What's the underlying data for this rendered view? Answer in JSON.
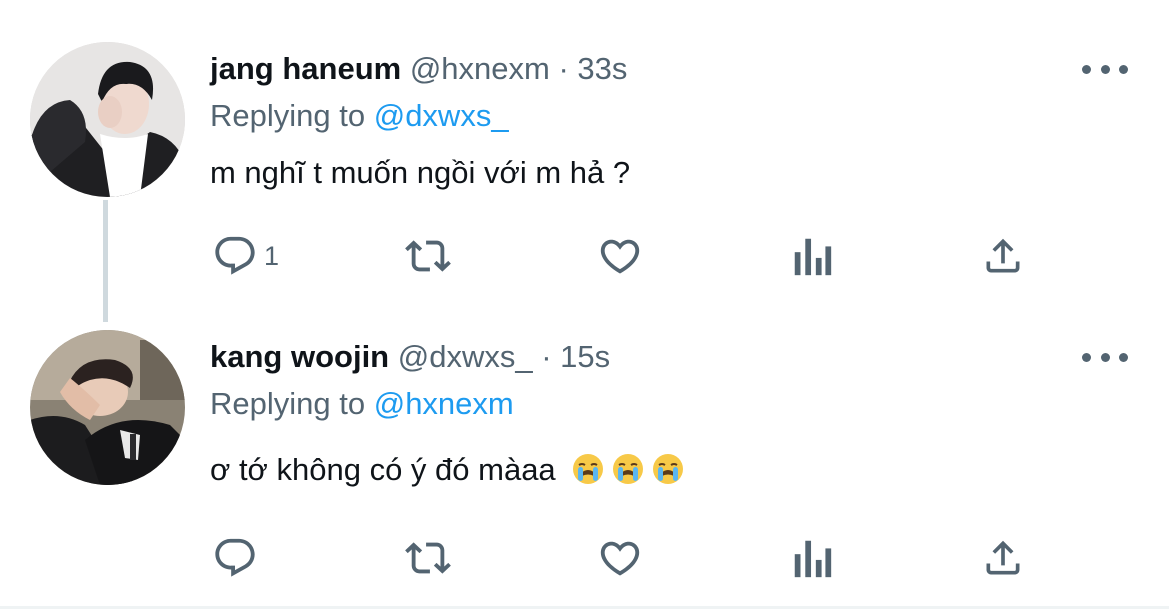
{
  "thread": [
    {
      "name": "jang haneum",
      "handle": "@hxnexm",
      "separator": "·",
      "time": "33s",
      "replying_prefix": "Replying to",
      "replying_to": "@dxwxs_",
      "text": "m nghĩ t muốn ngồi với m hả ?",
      "reply_count": "1",
      "avatar": "avatar-photo"
    },
    {
      "name": "kang woojin",
      "handle": "@dxwxs_",
      "separator": "·",
      "time": "15s",
      "replying_prefix": "Replying to",
      "replying_to": "@hxnexm",
      "text": "ơ tớ không có ý đó màaa",
      "emojis": [
        "loudly-crying-face",
        "loudly-crying-face",
        "loudly-crying-face"
      ],
      "reply_count": "",
      "avatar": "avatar-photo"
    }
  ],
  "colors": {
    "text": "#0f1419",
    "secondary": "#536471",
    "link": "#1d9bf0",
    "thread_line": "#cfd9de"
  },
  "icons": [
    "reply-icon",
    "retweet-icon",
    "like-icon",
    "analytics-icon",
    "share-icon",
    "more-icon"
  ]
}
